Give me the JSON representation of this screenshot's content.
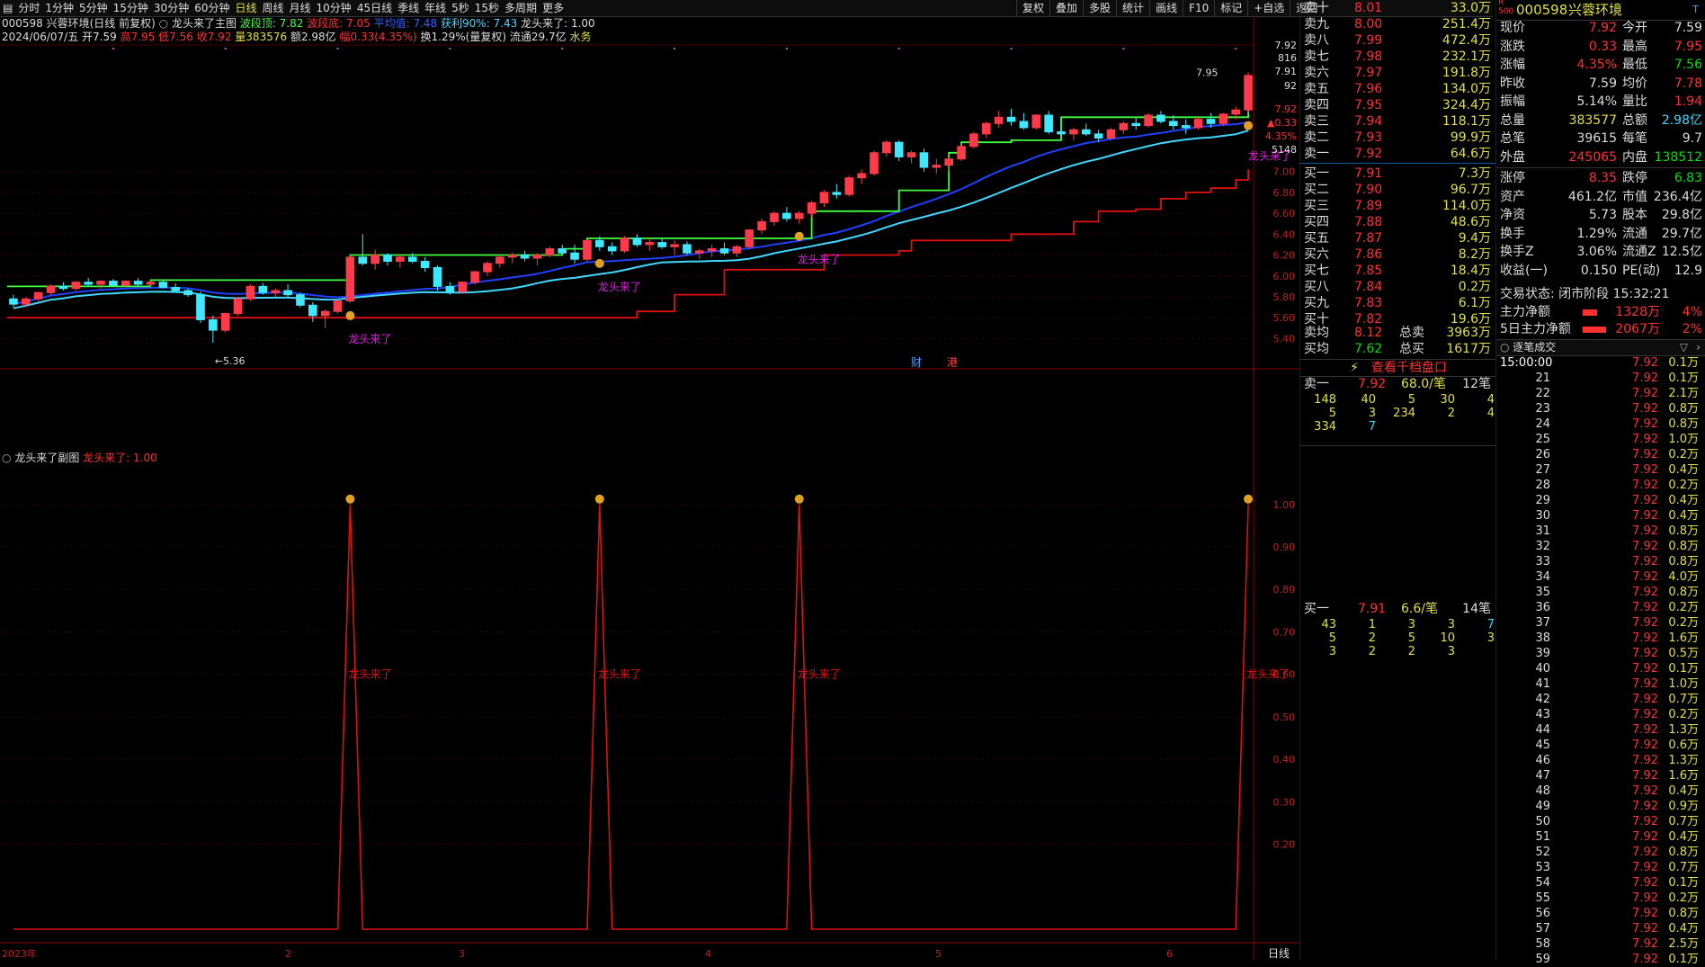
{
  "toolbar": {
    "periods": [
      "分时",
      "1分钟",
      "5分钟",
      "15分钟",
      "30分钟",
      "60分钟",
      "日线",
      "周线",
      "月线",
      "10分钟",
      "45日线",
      "季线",
      "年线",
      "5秒",
      "15秒",
      "多周期",
      "更多"
    ],
    "active_period": "日线",
    "tools": [
      "复权",
      "叠加",
      "多股",
      "统计",
      "画线",
      "F10",
      "标记",
      "+自选",
      "返回"
    ]
  },
  "header": {
    "stock_line": "000598 兴蓉环境(日线 前复权)",
    "indicator_name": "龙头来了主图",
    "bodong_label": "波段顶: 7.82",
    "bodi_label": "波段底: 7.05",
    "pingjun_label": "平均值: 7.48",
    "huoli_label": "获利90%: 7.43",
    "longtou_label": "龙头来了: 1.00",
    "date_line": "2024/06/07/五",
    "open": "开7.59",
    "high": "高7.95",
    "low": "低7.56",
    "close": "收7.92",
    "volume": "量383576",
    "amount": "额2.98亿",
    "change": "幅0.33(4.35%)",
    "turnover": "换1.29%(量复权)",
    "float_mv": "流通29.7亿",
    "water": "水务"
  },
  "main_chart": {
    "price_labels": [
      "7.92",
      "816",
      "7.91",
      "92",
      "7.92",
      "▲0.33",
      "4.35%",
      "5148",
      "7.00",
      "6.80",
      "6.60",
      "6.40",
      "6.20",
      "6.00",
      "5.80",
      "5.60",
      "5.40"
    ],
    "annotations": [
      "龙头来了",
      "龙头来了",
      "龙头来了",
      "龙头来了"
    ],
    "high_mark": "7.95",
    "low_mark": "5.36",
    "badges": [
      "财",
      "港"
    ]
  },
  "sub_chart": {
    "title": "龙头来了副图",
    "value_label": "龙头来了: 1.00",
    "y_labels": [
      "1.00",
      "0.90",
      "0.80",
      "0.70",
      "0.60",
      "0.50",
      "0.40",
      "0.30",
      "0.20"
    ],
    "annotations": [
      "龙头来了",
      "龙头来了",
      "龙头来了",
      "龙头来了"
    ],
    "x_labels": [
      "2023年",
      "2",
      "3",
      "4",
      "5",
      "6"
    ],
    "period_label": "日线"
  },
  "chart_data": {
    "type": "candlestick",
    "ohlc": [
      [
        5.78,
        5.82,
        5.7,
        5.73
      ],
      [
        5.73,
        5.8,
        5.7,
        5.78
      ],
      [
        5.78,
        5.85,
        5.76,
        5.84
      ],
      [
        5.84,
        5.92,
        5.82,
        5.9
      ],
      [
        5.9,
        5.94,
        5.86,
        5.88
      ],
      [
        5.88,
        5.95,
        5.86,
        5.94
      ],
      [
        5.94,
        5.98,
        5.9,
        5.92
      ],
      [
        5.92,
        5.96,
        5.88,
        5.95
      ],
      [
        5.95,
        5.97,
        5.9,
        5.91
      ],
      [
        5.91,
        5.96,
        5.89,
        5.95
      ],
      [
        5.95,
        5.98,
        5.9,
        5.92
      ],
      [
        5.92,
        5.96,
        5.88,
        5.94
      ],
      [
        5.94,
        5.96,
        5.88,
        5.89
      ],
      [
        5.89,
        5.93,
        5.84,
        5.86
      ],
      [
        5.86,
        5.88,
        5.8,
        5.82
      ],
      [
        5.82,
        5.85,
        5.55,
        5.58
      ],
      [
        5.58,
        5.62,
        5.36,
        5.48
      ],
      [
        5.48,
        5.65,
        5.46,
        5.64
      ],
      [
        5.64,
        5.8,
        5.62,
        5.78
      ],
      [
        5.78,
        5.92,
        5.76,
        5.9
      ],
      [
        5.9,
        5.93,
        5.82,
        5.84
      ],
      [
        5.84,
        5.88,
        5.8,
        5.86
      ],
      [
        5.86,
        5.92,
        5.8,
        5.82
      ],
      [
        5.82,
        5.84,
        5.7,
        5.72
      ],
      [
        5.72,
        5.75,
        5.56,
        5.62
      ],
      [
        5.62,
        5.68,
        5.5,
        5.66
      ],
      [
        5.66,
        5.78,
        5.64,
        5.76
      ],
      [
        5.76,
        6.2,
        5.74,
        6.18
      ],
      [
        6.18,
        6.4,
        6.1,
        6.12
      ],
      [
        6.12,
        6.25,
        6.06,
        6.2
      ],
      [
        6.2,
        6.22,
        6.1,
        6.14
      ],
      [
        6.14,
        6.2,
        6.08,
        6.18
      ],
      [
        6.18,
        6.22,
        6.12,
        6.14
      ],
      [
        6.14,
        6.18,
        6.04,
        6.08
      ],
      [
        6.08,
        6.1,
        5.86,
        5.9
      ],
      [
        5.9,
        5.94,
        5.82,
        5.85
      ],
      [
        5.85,
        5.95,
        5.83,
        5.94
      ],
      [
        5.94,
        6.05,
        5.92,
        6.04
      ],
      [
        6.04,
        6.14,
        6.0,
        6.12
      ],
      [
        6.12,
        6.2,
        6.08,
        6.18
      ],
      [
        6.18,
        6.22,
        6.12,
        6.2
      ],
      [
        6.2,
        6.24,
        6.14,
        6.17
      ],
      [
        6.17,
        6.22,
        6.1,
        6.2
      ],
      [
        6.2,
        6.28,
        6.18,
        6.26
      ],
      [
        6.26,
        6.3,
        6.2,
        6.22
      ],
      [
        6.22,
        6.3,
        6.12,
        6.16
      ],
      [
        6.16,
        6.35,
        6.14,
        6.34
      ],
      [
        6.34,
        6.38,
        6.24,
        6.28
      ],
      [
        6.28,
        6.32,
        6.2,
        6.24
      ],
      [
        6.24,
        6.38,
        6.22,
        6.36
      ],
      [
        6.36,
        6.4,
        6.28,
        6.3
      ],
      [
        6.3,
        6.36,
        6.24,
        6.32
      ],
      [
        6.32,
        6.36,
        6.26,
        6.28
      ],
      [
        6.28,
        6.34,
        6.2,
        6.3
      ],
      [
        6.3,
        6.33,
        6.2,
        6.22
      ],
      [
        6.22,
        6.26,
        6.16,
        6.24
      ],
      [
        6.24,
        6.3,
        6.18,
        6.26
      ],
      [
        6.26,
        6.32,
        6.2,
        6.22
      ],
      [
        6.22,
        6.3,
        6.18,
        6.28
      ],
      [
        6.28,
        6.45,
        6.26,
        6.44
      ],
      [
        6.44,
        6.55,
        6.4,
        6.52
      ],
      [
        6.52,
        6.62,
        6.48,
        6.6
      ],
      [
        6.6,
        6.66,
        6.52,
        6.55
      ],
      [
        6.55,
        6.62,
        6.5,
        6.6
      ],
      [
        6.6,
        6.72,
        6.56,
        6.7
      ],
      [
        6.7,
        6.82,
        6.66,
        6.8
      ],
      [
        6.8,
        6.88,
        6.74,
        6.78
      ],
      [
        6.78,
        6.96,
        6.76,
        6.94
      ],
      [
        6.94,
        7.02,
        6.88,
        6.98
      ],
      [
        6.98,
        7.2,
        6.96,
        7.18
      ],
      [
        7.18,
        7.3,
        7.14,
        7.28
      ],
      [
        7.28,
        7.3,
        7.1,
        7.14
      ],
      [
        7.14,
        7.2,
        7.08,
        7.18
      ],
      [
        7.18,
        7.22,
        7.0,
        7.04
      ],
      [
        7.04,
        7.12,
        6.98,
        7.06
      ],
      [
        7.06,
        7.14,
        7.0,
        7.12
      ],
      [
        7.12,
        7.26,
        7.1,
        7.24
      ],
      [
        7.24,
        7.38,
        7.22,
        7.36
      ],
      [
        7.36,
        7.48,
        7.32,
        7.46
      ],
      [
        7.46,
        7.58,
        7.42,
        7.52
      ],
      [
        7.52,
        7.6,
        7.44,
        7.48
      ],
      [
        7.48,
        7.56,
        7.4,
        7.42
      ],
      [
        7.42,
        7.55,
        7.4,
        7.54
      ],
      [
        7.54,
        7.58,
        7.36,
        7.38
      ],
      [
        7.38,
        7.44,
        7.32,
        7.36
      ],
      [
        7.36,
        7.42,
        7.3,
        7.4
      ],
      [
        7.4,
        7.46,
        7.34,
        7.36
      ],
      [
        7.36,
        7.4,
        7.28,
        7.32
      ],
      [
        7.32,
        7.42,
        7.3,
        7.4
      ],
      [
        7.4,
        7.48,
        7.36,
        7.46
      ],
      [
        7.46,
        7.52,
        7.4,
        7.44
      ],
      [
        7.44,
        7.56,
        7.42,
        7.54
      ],
      [
        7.54,
        7.58,
        7.46,
        7.48
      ],
      [
        7.48,
        7.54,
        7.4,
        7.44
      ],
      [
        7.44,
        7.5,
        7.36,
        7.42
      ],
      [
        7.42,
        7.52,
        7.4,
        7.5
      ],
      [
        7.5,
        7.56,
        7.42,
        7.46
      ],
      [
        7.46,
        7.56,
        7.44,
        7.55
      ],
      [
        7.55,
        7.62,
        7.5,
        7.59
      ],
      [
        7.59,
        7.95,
        7.56,
        7.92
      ]
    ],
    "signal_indices": [
      27,
      47,
      63,
      100
    ],
    "support_steps": [
      [
        0,
        5.6
      ],
      [
        45,
        5.6
      ],
      [
        50,
        5.66
      ],
      [
        53,
        5.82
      ],
      [
        56,
        5.82
      ],
      [
        57,
        6.06
      ],
      [
        64,
        6.06
      ],
      [
        65,
        6.2
      ],
      [
        71,
        6.24
      ],
      [
        72,
        6.34
      ],
      [
        80,
        6.4
      ],
      [
        85,
        6.52
      ],
      [
        87,
        6.62
      ],
      [
        90,
        6.64
      ],
      [
        92,
        6.74
      ],
      [
        94,
        6.8
      ],
      [
        96,
        6.84
      ],
      [
        98,
        6.92
      ],
      [
        100,
        7.02
      ]
    ],
    "top_steps": [
      [
        0,
        5.9
      ],
      [
        11,
        5.96
      ],
      [
        27,
        6.2
      ],
      [
        44,
        6.26
      ],
      [
        45,
        6.26
      ],
      [
        46,
        6.36
      ],
      [
        63,
        6.36
      ],
      [
        64,
        6.62
      ],
      [
        70,
        6.62
      ],
      [
        71,
        6.82
      ],
      [
        74,
        6.82
      ],
      [
        75,
        7.18
      ],
      [
        76,
        7.28
      ],
      [
        80,
        7.3
      ],
      [
        84,
        7.52
      ],
      [
        100,
        7.52
      ],
      [
        101,
        7.92
      ]
    ],
    "sub_values": "1.00 at signal_indices, 0.00 elsewhere",
    "y_range_main": [
      5.3,
      8.1
    ],
    "y_range_sub": [
      0,
      1.08
    ]
  },
  "orderbook": {
    "asks": [
      {
        "label": "卖十",
        "price": "8.01",
        "vol": "33.0万"
      },
      {
        "label": "卖九",
        "price": "8.00",
        "vol": "251.4万"
      },
      {
        "label": "卖八",
        "price": "7.99",
        "vol": "472.4万"
      },
      {
        "label": "卖七",
        "price": "7.98",
        "vol": "232.1万"
      },
      {
        "label": "卖六",
        "price": "7.97",
        "vol": "191.8万"
      },
      {
        "label": "卖五",
        "price": "7.96",
        "vol": "134.0万"
      },
      {
        "label": "卖四",
        "price": "7.95",
        "vol": "324.4万"
      },
      {
        "label": "卖三",
        "price": "7.94",
        "vol": "118.1万"
      },
      {
        "label": "卖二",
        "price": "7.93",
        "vol": "99.9万"
      },
      {
        "label": "卖一",
        "price": "7.92",
        "vol": "64.6万"
      }
    ],
    "bids": [
      {
        "label": "买一",
        "price": "7.91",
        "vol": "7.3万"
      },
      {
        "label": "买二",
        "price": "7.90",
        "vol": "96.7万"
      },
      {
        "label": "买三",
        "price": "7.89",
        "vol": "114.0万"
      },
      {
        "label": "买四",
        "price": "7.88",
        "vol": "48.6万"
      },
      {
        "label": "买五",
        "price": "7.87",
        "vol": "9.4万"
      },
      {
        "label": "买六",
        "price": "7.86",
        "vol": "8.2万"
      },
      {
        "label": "买七",
        "price": "7.85",
        "vol": "18.4万"
      },
      {
        "label": "买八",
        "price": "7.84",
        "vol": "0.2万"
      },
      {
        "label": "买九",
        "price": "7.83",
        "vol": "6.1万"
      },
      {
        "label": "买十",
        "price": "7.82",
        "vol": "19.6万"
      }
    ],
    "avg_sell_label": "卖均",
    "avg_sell": "8.12",
    "total_sell_label": "总卖",
    "total_sell": "3963万",
    "avg_buy_label": "买均",
    "avg_buy": "7.62",
    "total_buy_label": "总买",
    "total_buy": "1617万",
    "thousand_link": "查看千档盘口",
    "sell1": {
      "label": "卖一",
      "price": "7.92",
      "per": "68.0/笔",
      "count": "12笔"
    },
    "sell1_queue": [
      [
        "148",
        "40",
        "5",
        "30",
        "4"
      ],
      [
        "5",
        "3",
        "234",
        "2",
        "4"
      ],
      [
        "334",
        "7",
        "",
        "",
        ""
      ]
    ],
    "buy1": {
      "label": "买一",
      "price": "7.91",
      "per": "6.6/笔",
      "count": "14笔"
    },
    "buy1_queue": [
      [
        "43",
        "1",
        "3",
        "3",
        "7"
      ],
      [
        "5",
        "2",
        "5",
        "10",
        "3"
      ],
      [
        "3",
        "2",
        "2",
        "3",
        ""
      ]
    ]
  },
  "info": {
    "code": "000598",
    "name": "兴蓉环境",
    "badge": "R 500",
    "rows": [
      [
        "现价",
        "7.92",
        "今开",
        "7.59"
      ],
      [
        "涨跌",
        "0.33",
        "最高",
        "7.95"
      ],
      [
        "涨幅",
        "4.35%",
        "最低",
        "7.56"
      ],
      [
        "昨收",
        "7.59",
        "均价",
        "7.78"
      ],
      [
        "振幅",
        "5.14%",
        "量比",
        "1.94"
      ],
      [
        "总量",
        "383577",
        "总额",
        "2.98亿"
      ],
      [
        "总笔",
        "39615",
        "每笔",
        "9.7"
      ],
      [
        "外盘",
        "245065",
        "内盘",
        "138512"
      ],
      [
        "涨停",
        "8.35",
        "跌停",
        "6.83"
      ],
      [
        "资产",
        "461.2亿",
        "市值",
        "236.4亿"
      ],
      [
        "净资",
        "5.73",
        "股本",
        "29.8亿"
      ],
      [
        "换手",
        "1.29%",
        "流通",
        "29.7亿"
      ],
      [
        "换手Z",
        "3.06%",
        "流通Z",
        "12.5亿"
      ],
      [
        "收益(一)",
        "0.150",
        "PE(动)",
        "12.9"
      ]
    ],
    "status": "交易状态: 闭市阶段 15:32:21",
    "main_flow_label": "主力净额",
    "main_flow": "1328万",
    "main_flow_pct": "4%",
    "flow5_label": "5日主力净额",
    "flow5": "2067万",
    "flow5_pct": "2%",
    "ticks_title": "逐笔成交",
    "ticks": [
      [
        "15:00:00",
        "7.92",
        "0.1万"
      ],
      [
        "21",
        "7.92",
        "0.1万"
      ],
      [
        "22",
        "7.92",
        "2.1万"
      ],
      [
        "23",
        "7.92",
        "0.8万"
      ],
      [
        "24",
        "7.92",
        "0.8万"
      ],
      [
        "25",
        "7.92",
        "1.0万"
      ],
      [
        "26",
        "7.92",
        "0.2万"
      ],
      [
        "27",
        "7.92",
        "0.4万"
      ],
      [
        "28",
        "7.92",
        "0.2万"
      ],
      [
        "29",
        "7.92",
        "0.4万"
      ],
      [
        "30",
        "7.92",
        "0.4万"
      ],
      [
        "31",
        "7.92",
        "0.8万"
      ],
      [
        "32",
        "7.92",
        "0.8万"
      ],
      [
        "33",
        "7.92",
        "0.8万"
      ],
      [
        "34",
        "7.92",
        "4.0万"
      ],
      [
        "35",
        "7.92",
        "0.8万"
      ],
      [
        "36",
        "7.92",
        "0.2万"
      ],
      [
        "37",
        "7.92",
        "0.2万"
      ],
      [
        "38",
        "7.92",
        "1.6万"
      ],
      [
        "39",
        "7.92",
        "0.5万"
      ],
      [
        "40",
        "7.92",
        "0.1万"
      ],
      [
        "41",
        "7.92",
        "1.0万"
      ],
      [
        "42",
        "7.92",
        "0.7万"
      ],
      [
        "43",
        "7.92",
        "0.2万"
      ],
      [
        "44",
        "7.92",
        "1.3万"
      ],
      [
        "45",
        "7.92",
        "0.6万"
      ],
      [
        "46",
        "7.92",
        "1.3万"
      ],
      [
        "47",
        "7.92",
        "1.6万"
      ],
      [
        "48",
        "7.92",
        "0.4万"
      ],
      [
        "49",
        "7.92",
        "0.9万"
      ],
      [
        "50",
        "7.92",
        "0.7万"
      ],
      [
        "51",
        "7.92",
        "0.4万"
      ],
      [
        "52",
        "7.92",
        "0.8万"
      ],
      [
        "53",
        "7.92",
        "0.7万"
      ],
      [
        "54",
        "7.92",
        "0.1万"
      ],
      [
        "55",
        "7.92",
        "0.2万"
      ],
      [
        "56",
        "7.92",
        "0.8万"
      ],
      [
        "57",
        "7.92",
        "0.4万"
      ],
      [
        "58",
        "7.92",
        "2.5万"
      ],
      [
        "59",
        "7.92",
        "0.1万"
      ]
    ]
  }
}
